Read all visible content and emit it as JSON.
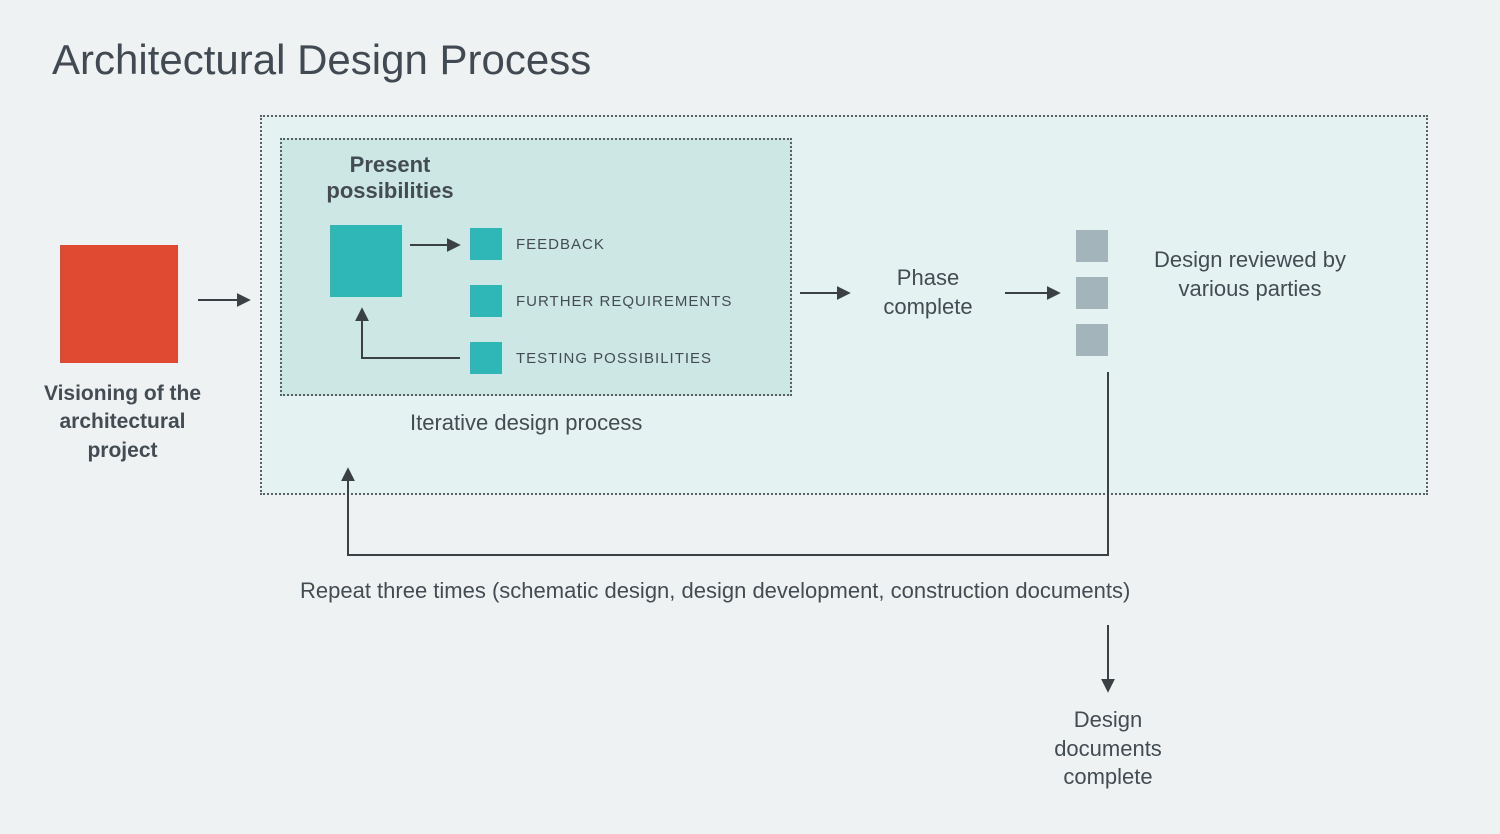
{
  "title": "Architectural Design Process",
  "visioning": "Visioning of the architectural project",
  "present": "Present possibilities",
  "feedback_items": {
    "a": "FEEDBACK",
    "b": "FURTHER REQUIREMENTS",
    "c": "TESTING POSSIBILITIES"
  },
  "iterative": "Iterative design process",
  "phase": "Phase complete",
  "review": "Design reviewed by various parties",
  "repeat": "Repeat three times (schematic design, design development, construction documents)",
  "complete": "Design documents complete",
  "colors": {
    "red": "#e14a32",
    "teal": "#2fb6b6",
    "grey": "#a4b4bb",
    "inner_bg": "#cde7e4",
    "outer_bg": "#e4f2f1"
  }
}
